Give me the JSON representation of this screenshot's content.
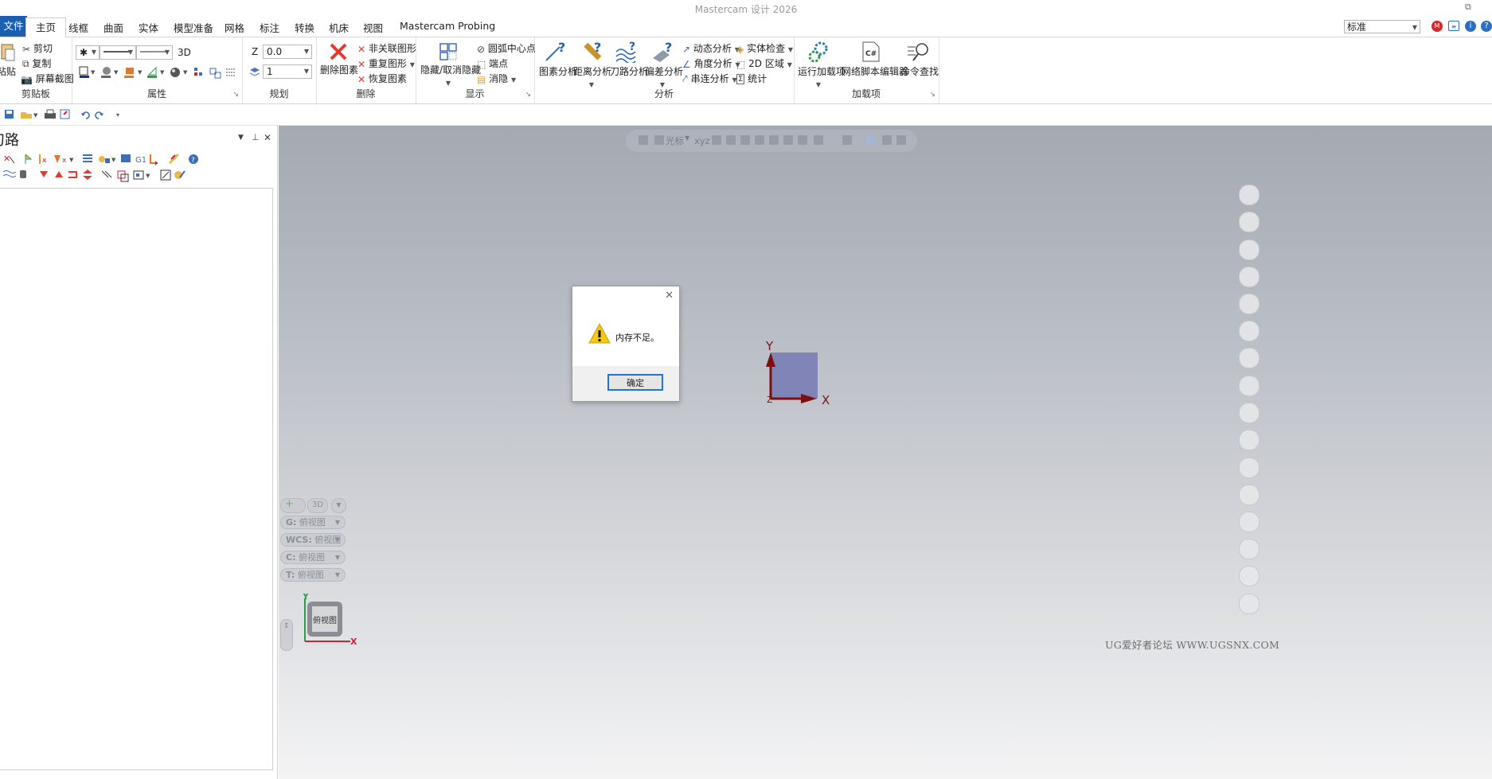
{
  "app": {
    "title": "Mastercam 设计 2026",
    "style_dropdown": "标准"
  },
  "tabs": [
    "文件",
    "主页",
    "线框",
    "曲面",
    "实体",
    "模型准备",
    "网格",
    "标注",
    "转换",
    "机床",
    "视图",
    "Mastercam Probing"
  ],
  "ribbon": {
    "clipboard": {
      "label": "剪贴板",
      "paste": "粘贴",
      "cut": "剪切",
      "copy": "复制",
      "screenshot": "屏幕截图"
    },
    "attributes": {
      "label": "属性",
      "mode": "3D"
    },
    "planning": {
      "label": "规划",
      "z_label": "Z",
      "z_value": "0.0",
      "level_value": "1"
    },
    "delete": {
      "label": "删除",
      "delete_entities": "删除图素",
      "unrelated": "非关联图形",
      "duplicate": "重复图形",
      "restore": "恢复图素"
    },
    "display": {
      "label": "显示",
      "hide_unhide": "隐藏/取消隐藏",
      "arc_center": "圆弧中心点",
      "endpoints": "端点",
      "blank": "消隐"
    },
    "analysis": {
      "label": "分析",
      "entity": "图素分析",
      "distance": "距离分析",
      "toolpath": "刀路分析",
      "deviation": "偏差分析",
      "dynamic": "动态分析",
      "angle": "角度分析",
      "chain": "串连分析",
      "solid_check": "实体检查",
      "area_2d": "2D 区域",
      "stats": "统计"
    },
    "addins": {
      "label": "加载项",
      "run": "运行加载项",
      "script_editor": "网络脚本编辑器",
      "cmd_finder": "命令查找",
      "csharp_badge": "C#"
    }
  },
  "panel": {
    "title": "刀路"
  },
  "viewport": {
    "toolbar_cursor": "光标",
    "toolbar_xyz": "xyz",
    "mode_3d": "3D",
    "views": [
      {
        "prefix": "G:",
        "value": "俯视图"
      },
      {
        "prefix": "WCS:",
        "value": "俯视图"
      },
      {
        "prefix": "C:",
        "value": "俯视图"
      },
      {
        "prefix": "T:",
        "value": "俯视图"
      }
    ],
    "cube_label": "俯视图",
    "axis_x": "X",
    "axis_y": "Y",
    "axis_z": "Z",
    "colors": {
      "origin_square": "#8184b6",
      "axis": "#7a1010"
    }
  },
  "dialog": {
    "message": "内存不足。",
    "ok": "确定"
  },
  "watermark": "UG爱好者论坛 WWW.UGSNX.COM"
}
